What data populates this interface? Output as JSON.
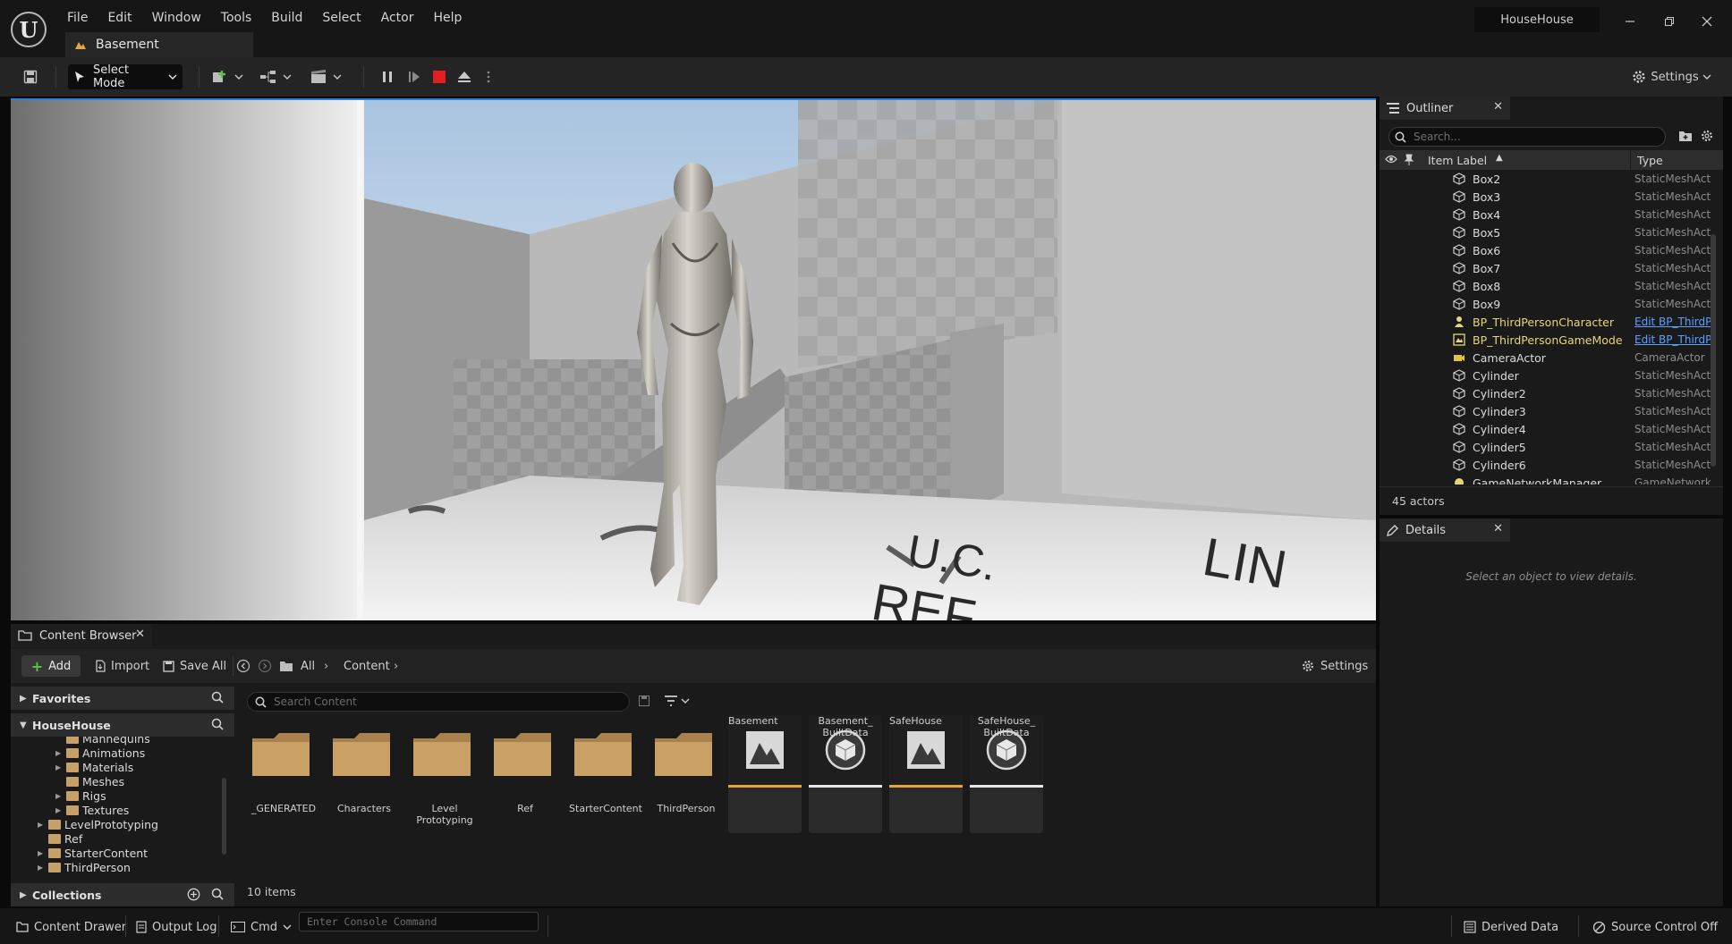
{
  "app": {
    "project_name": "HouseHouse",
    "level_tab": "Basement",
    "menu": [
      "File",
      "Edit",
      "Window",
      "Tools",
      "Build",
      "Select",
      "Actor",
      "Help"
    ]
  },
  "toolbar": {
    "select_mode": "Select Mode",
    "settings": "Settings"
  },
  "outliner": {
    "title": "Outliner",
    "search_placeholder": "Search...",
    "col_label": "Item Label",
    "col_type": "Type",
    "rows": [
      {
        "label": "Box2",
        "type": "StaticMeshActor",
        "icon": "static-mesh-icon"
      },
      {
        "label": "Box3",
        "type": "StaticMeshActor",
        "icon": "static-mesh-icon"
      },
      {
        "label": "Box4",
        "type": "StaticMeshActor",
        "icon": "static-mesh-icon"
      },
      {
        "label": "Box5",
        "type": "StaticMeshActor",
        "icon": "static-mesh-icon"
      },
      {
        "label": "Box6",
        "type": "StaticMeshActor",
        "icon": "static-mesh-icon"
      },
      {
        "label": "Box7",
        "type": "StaticMeshActor",
        "icon": "static-mesh-icon"
      },
      {
        "label": "Box8",
        "type": "StaticMeshActor",
        "icon": "static-mesh-icon"
      },
      {
        "label": "Box9",
        "type": "StaticMeshActor",
        "icon": "static-mesh-icon"
      },
      {
        "label": "BP_ThirdPersonCharacter",
        "type": "Edit BP_ThirdPersonCharacter",
        "icon": "character-icon",
        "link": true
      },
      {
        "label": "BP_ThirdPersonGameMode",
        "type": "Edit BP_ThirdPersonGameMode",
        "icon": "game-mode-icon",
        "link": true
      },
      {
        "label": "CameraActor",
        "type": "CameraActor",
        "icon": "camera-icon"
      },
      {
        "label": "Cylinder",
        "type": "StaticMeshActor",
        "icon": "static-mesh-icon"
      },
      {
        "label": "Cylinder2",
        "type": "StaticMeshActor",
        "icon": "static-mesh-icon"
      },
      {
        "label": "Cylinder3",
        "type": "StaticMeshActor",
        "icon": "static-mesh-icon"
      },
      {
        "label": "Cylinder4",
        "type": "StaticMeshActor",
        "icon": "static-mesh-icon"
      },
      {
        "label": "Cylinder5",
        "type": "StaticMeshActor",
        "icon": "static-mesh-icon"
      },
      {
        "label": "Cylinder6",
        "type": "StaticMeshActor",
        "icon": "static-mesh-icon"
      },
      {
        "label": "GameNetworkManager",
        "type": "GameNetworkManager",
        "icon": "network-manager-icon"
      }
    ],
    "actor_count": "45 actors"
  },
  "details": {
    "title": "Details",
    "empty_message": "Select an object to view details."
  },
  "content_browser": {
    "title": "Content Browser",
    "add": "Add",
    "import": "Import",
    "save_all": "Save All",
    "path_all": "All",
    "path_content": "Content",
    "settings": "Settings",
    "favorites": "Favorites",
    "project": "HouseHouse",
    "collections": "Collections",
    "search_placeholder": "Search Content",
    "tree": [
      {
        "label": "Mannequins"
      },
      {
        "label": "Animations"
      },
      {
        "label": "Materials"
      },
      {
        "label": "Meshes"
      },
      {
        "label": "Rigs"
      },
      {
        "label": "Textures"
      },
      {
        "label": "LevelPrototyping"
      },
      {
        "label": "Ref"
      },
      {
        "label": "StarterContent"
      },
      {
        "label": "ThirdPerson"
      }
    ],
    "folders": [
      "_GENERATED",
      "Characters",
      "Level Prototyping",
      "Ref",
      "StarterContent",
      "ThirdPerson"
    ],
    "assets": [
      {
        "name": "Basement",
        "kind": "map",
        "bar_color": "#e8a33d"
      },
      {
        "name": "Basement_ BuiltData",
        "kind": "data",
        "bar_color": "#e6e6e6"
      },
      {
        "name": "SafeHouse",
        "kind": "map",
        "bar_color": "#e8a33d"
      },
      {
        "name": "SafeHouse_ BuiltData",
        "kind": "data",
        "bar_color": "#e6e6e6"
      }
    ],
    "items_count": "10 items"
  },
  "statusbar": {
    "content_drawer": "Content Drawer",
    "output_log": "Output Log",
    "cmd": "Cmd",
    "console_placeholder": "Enter Console Command",
    "derived_data": "Derived Data",
    "source_control": "Source Control Off"
  },
  "colors": {
    "accent_blue": "#2a7fd8",
    "stop_red": "#e02020",
    "folder": "#c6a06a",
    "map_bar": "#e8a33d"
  }
}
